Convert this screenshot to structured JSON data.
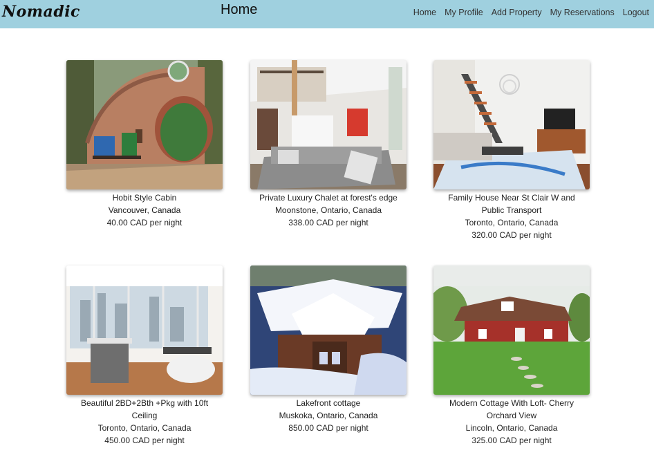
{
  "app": {
    "brand": "Nomadic",
    "page_title": "Home"
  },
  "nav": {
    "links": [
      "Home",
      "My Profile",
      "Add Property",
      "My Reservations",
      "Logout"
    ]
  },
  "listings": [
    {
      "title": "Hobit Style Cabin",
      "location": "Vancouver, Canada",
      "price": "40.00 CAD per night",
      "photo": "hobbit-cabin-photo"
    },
    {
      "title": "Private Luxury Chalet at forest's edge",
      "location": "Moonstone, Ontario, Canada",
      "price": "338.00 CAD per night",
      "photo": "chalet-interior-photo"
    },
    {
      "title": "Family House Near St Clair W and Public Transport",
      "location": "Toronto, Ontario, Canada",
      "price": "320.00 CAD per night",
      "photo": "family-house-interior-photo"
    },
    {
      "title": "Beautiful 2BD+2Bth +Pkg with 10ft Ceiling",
      "location": "Toronto, Ontario, Canada",
      "price": "450.00 CAD per night",
      "photo": "condo-interior-photo"
    },
    {
      "title": "Lakefront cottage",
      "location": "Muskoka, Ontario, Canada",
      "price": "850.00 CAD per night",
      "photo": "snowy-cottage-photo"
    },
    {
      "title": "Modern Cottage With Loft- Cherry Orchard View",
      "location": "Lincoln, Ontario, Canada",
      "price": "325.00 CAD per night",
      "photo": "red-barn-cottage-photo"
    }
  ]
}
